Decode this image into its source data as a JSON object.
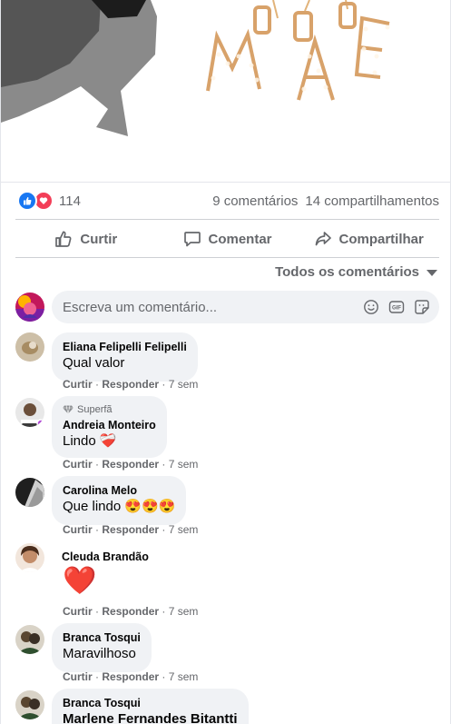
{
  "stats": {
    "reactions_count": "114",
    "comments": "9 comentários",
    "shares": "14 compartilhamentos"
  },
  "actions": {
    "like": "Curtir",
    "comment": "Comentar",
    "share": "Compartilhar"
  },
  "filter": {
    "label": "Todos os comentários"
  },
  "composer": {
    "placeholder": "Escreva um comentário..."
  },
  "comment_meta": {
    "like": "Curtir",
    "reply": "Responder",
    "sep": "·"
  },
  "comments": [
    {
      "name": "Eliana Felipelli Felipelli",
      "text": "Qual valor",
      "time": "7 sem"
    },
    {
      "badge": "Superfã",
      "name": "Andreia Monteiro",
      "text": "Lindo",
      "emoji": "❤️‍🩹",
      "time": "7 sem"
    },
    {
      "name": "Carolina Melo",
      "text": "Que lindo",
      "emoji": "😍😍😍",
      "time": "7 sem"
    },
    {
      "name": "Cleuda Brandão",
      "emoji": "❤️",
      "time": "7 sem"
    },
    {
      "name": "Branca Tosqui",
      "text": "Maravilhoso",
      "time": "7 sem"
    },
    {
      "name": "Branca Tosqui",
      "text": "Marlene Fernandes Bitantti"
    }
  ],
  "colors": {
    "like_blue": "#1877f2",
    "love_red": "#f33e58",
    "muted": "#65676b",
    "bubble_bg": "#f0f2f5"
  }
}
